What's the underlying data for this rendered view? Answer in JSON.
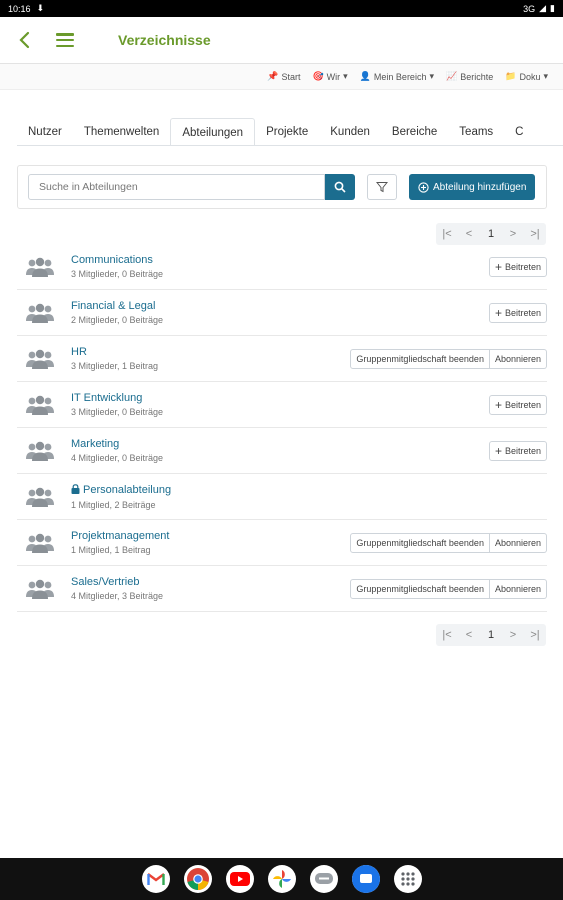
{
  "status": {
    "time": "10:16",
    "network": "3G"
  },
  "appbar": {
    "title": "Verzeichnisse"
  },
  "topnav": [
    {
      "label": "Start",
      "icon": "pin-icon",
      "dropdown": false
    },
    {
      "label": "Wir",
      "icon": "target-icon",
      "dropdown": true
    },
    {
      "label": "Mein Bereich",
      "icon": "user-icon",
      "dropdown": true
    },
    {
      "label": "Berichte",
      "icon": "chart-icon",
      "dropdown": false
    },
    {
      "label": "Doku",
      "icon": "folder-icon",
      "dropdown": true
    }
  ],
  "tabs": [
    "Nutzer",
    "Themenwelten",
    "Abteilungen",
    "Projekte",
    "Kunden",
    "Bereiche",
    "Teams",
    "C"
  ],
  "active_tab": 2,
  "search": {
    "placeholder": "Suche in Abteilungen",
    "add_label": "Abteilung hinzufügen"
  },
  "pager": {
    "first": "|<",
    "prev": "<",
    "current": "1",
    "next": ">",
    "last": ">|"
  },
  "rows": [
    {
      "name": "Communications",
      "meta": "3 Mitglieder, 0 Beiträge",
      "locked": false,
      "join": "Beitreten"
    },
    {
      "name": "Financial & Legal",
      "meta": "2 Mitglieder, 0 Beiträge",
      "locked": false,
      "join": "Beitreten"
    },
    {
      "name": "HR",
      "meta": "3 Mitglieder, 1 Beitrag",
      "locked": false,
      "leave": "Gruppenmitgliedschaft beenden",
      "subscribe": "Abonnieren"
    },
    {
      "name": "IT Entwicklung",
      "meta": "3 Mitglieder, 0 Beiträge",
      "locked": false,
      "join": "Beitreten"
    },
    {
      "name": "Marketing",
      "meta": "4 Mitglieder, 0 Beiträge",
      "locked": false,
      "join": "Beitreten"
    },
    {
      "name": "Personalabteilung",
      "meta": "1 Mitglied, 2 Beiträge",
      "locked": true
    },
    {
      "name": "Projektmanagement",
      "meta": "1 Mitglied, 1 Beitrag",
      "locked": false,
      "leave": "Gruppenmitgliedschaft beenden",
      "subscribe": "Abonnieren"
    },
    {
      "name": "Sales/Vertrieb",
      "meta": "4 Mitglieder, 3 Beiträge",
      "locked": false,
      "leave": "Gruppenmitgliedschaft beenden",
      "subscribe": "Abonnieren"
    }
  ],
  "dock": [
    "gmail-icon",
    "chrome-icon",
    "youtube-icon",
    "photos-icon",
    "messages-icon",
    "chat-icon",
    "apps-icon"
  ],
  "colors": {
    "accent": "#6a9a2b",
    "primary": "#1b6d8f",
    "link": "#1b6d8f"
  }
}
